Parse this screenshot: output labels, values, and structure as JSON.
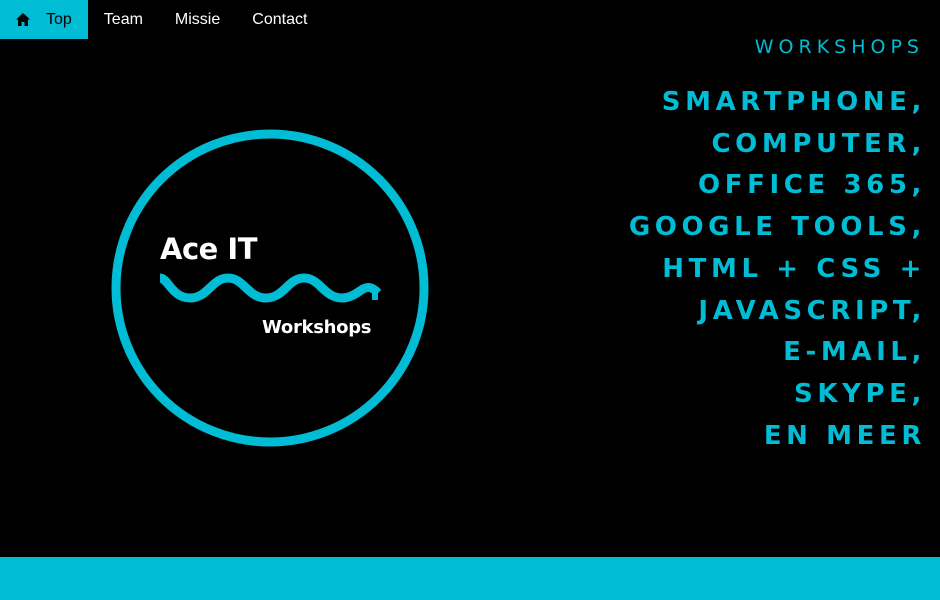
{
  "nav": {
    "items": [
      {
        "label": "Top",
        "icon": "home-icon",
        "active": true
      },
      {
        "label": "Team",
        "active": false
      },
      {
        "label": "Missie",
        "active": false
      },
      {
        "label": "Contact",
        "active": false
      }
    ]
  },
  "logo": {
    "title": "Ace IT",
    "subtitle": "Workshops"
  },
  "hero": {
    "heading": "WORKSHOPS",
    "topics": [
      "SMARTPHONE,",
      "COMPUTER,",
      "OFFICE 365,",
      "GOOGLE TOOLS,",
      "HTML + CSS +",
      "JAVASCRIPT,",
      "E-MAIL,",
      "SKYPE,",
      "EN MEER"
    ]
  },
  "colors": {
    "accent": "#00bcd4",
    "background": "#000000",
    "text": "#ffffff"
  }
}
